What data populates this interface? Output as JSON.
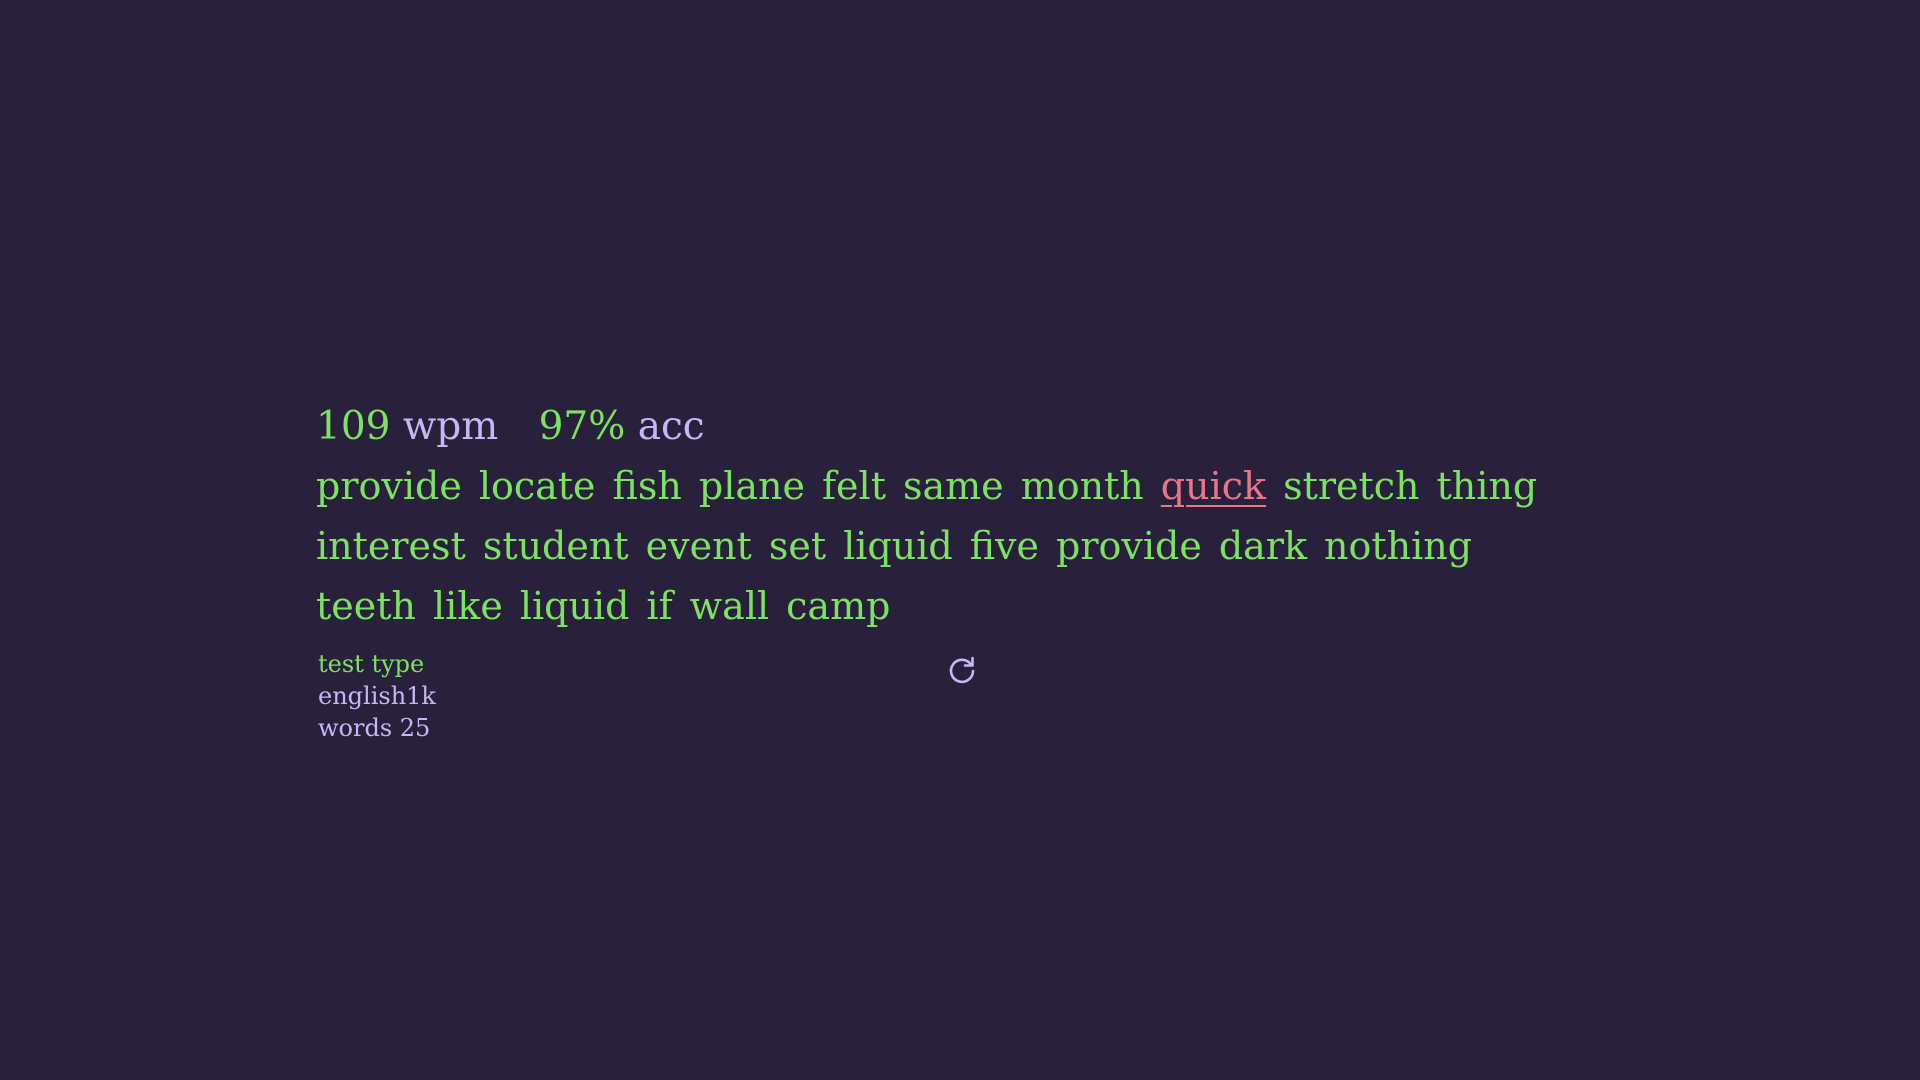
{
  "stats": {
    "wpm_value": "109",
    "wpm_unit": "wpm",
    "acc_value": "97%",
    "acc_unit": "acc"
  },
  "words": [
    {
      "text": "provide",
      "state": "correct"
    },
    {
      "text": "locate",
      "state": "correct"
    },
    {
      "text": "fish",
      "state": "correct"
    },
    {
      "text": "plane",
      "state": "correct"
    },
    {
      "text": "felt",
      "state": "correct"
    },
    {
      "text": "same",
      "state": "correct"
    },
    {
      "text": "month",
      "state": "correct"
    },
    {
      "text": "quick",
      "state": "error"
    },
    {
      "text": "stretch",
      "state": "correct"
    },
    {
      "text": "thing",
      "state": "correct"
    },
    {
      "text": "interest",
      "state": "correct"
    },
    {
      "text": "student",
      "state": "correct"
    },
    {
      "text": "event",
      "state": "correct"
    },
    {
      "text": "set",
      "state": "correct"
    },
    {
      "text": "liquid",
      "state": "correct"
    },
    {
      "text": "five",
      "state": "correct"
    },
    {
      "text": "provide",
      "state": "correct"
    },
    {
      "text": "dark",
      "state": "correct"
    },
    {
      "text": "nothing",
      "state": "correct"
    },
    {
      "text": "teeth",
      "state": "correct"
    },
    {
      "text": "like",
      "state": "correct"
    },
    {
      "text": "liquid",
      "state": "correct"
    },
    {
      "text": "if",
      "state": "correct"
    },
    {
      "text": "wall",
      "state": "correct"
    },
    {
      "text": "camp",
      "state": "correct"
    }
  ],
  "info": {
    "label": "test type",
    "language": "english1k",
    "mode": "words 25"
  },
  "restart_icon": "restart-icon",
  "colors": {
    "background": "#29213c",
    "correct": "#7ce361",
    "error": "#e7768a",
    "sub": "#c7b5f5"
  }
}
